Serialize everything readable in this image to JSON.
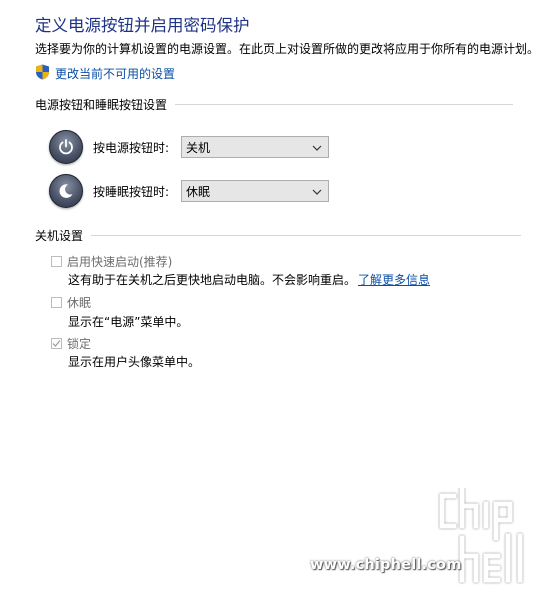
{
  "header": {
    "title": "定义电源按钮并启用密码保护",
    "description": "选择要为你的计算机设置的电源设置。在此页上对设置所做的更改将应用于你所有的电源计划。",
    "change_link": "更改当前不可用的设置"
  },
  "power_buttons": {
    "section_title": "电源按钮和睡眠按钮设置",
    "power": {
      "label": "按电源按钮时:",
      "value": "关机"
    },
    "sleep": {
      "label": "按睡眠按钮时:",
      "value": "休眠"
    }
  },
  "shutdown": {
    "section_title": "关机设置",
    "options": [
      {
        "label": "启用快速启动(推荐)",
        "checked": false,
        "disabled": true,
        "hint": "这有助于在关机之后更快地启动电脑。不会影响重启。",
        "link": "了解更多信息"
      },
      {
        "label": "休眠",
        "checked": false,
        "disabled": true,
        "hint": "显示在“电源”菜单中。"
      },
      {
        "label": "锁定",
        "checked": true,
        "disabled": true,
        "hint": "显示在用户头像菜单中。"
      }
    ]
  },
  "watermark": {
    "url": "www.chiphell.com",
    "logo_text": "chip hell"
  },
  "icons": {
    "shield": "uac-shield-icon",
    "power": "power-icon",
    "sleep": "moon-icon",
    "dropdown": "chevron-down-icon"
  }
}
